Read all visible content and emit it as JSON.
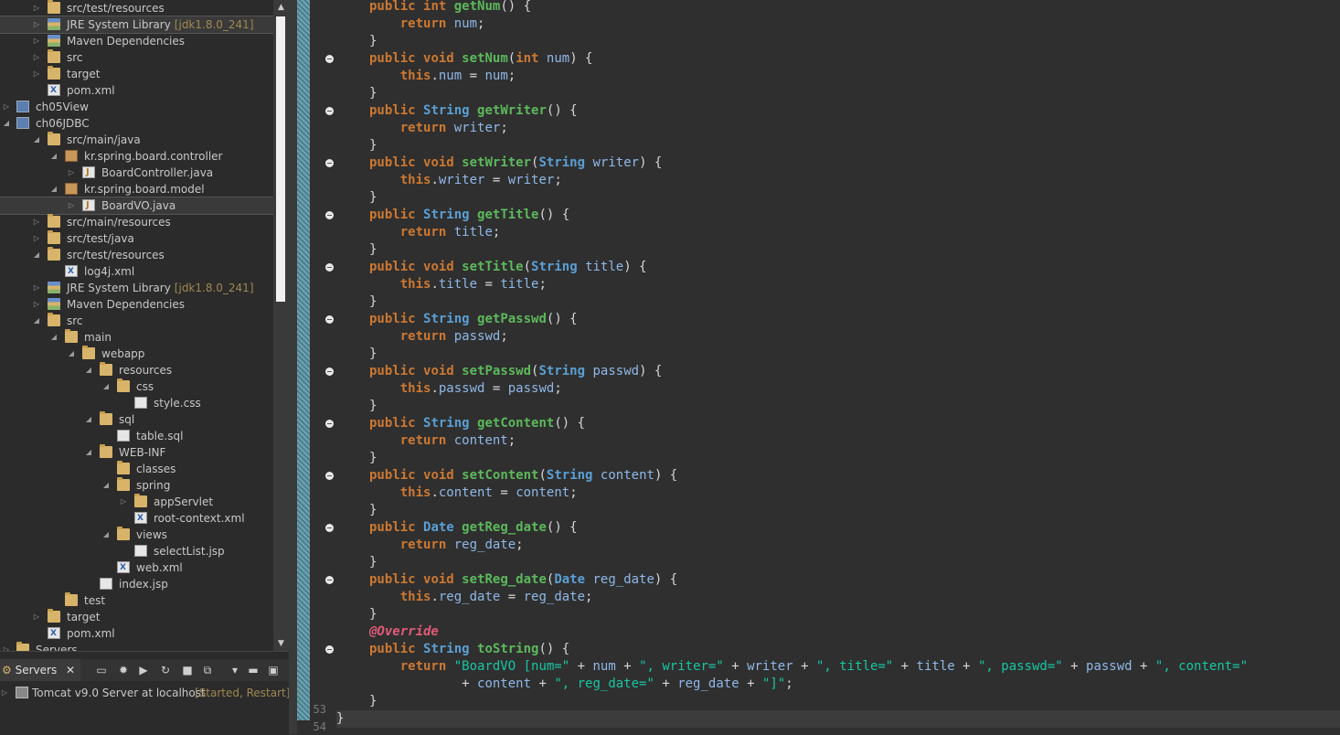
{
  "explorer": {
    "rows": [
      {
        "label": "src/test/resources",
        "decoration": "",
        "indent": 1,
        "twisty": "▷",
        "icon": "folder-icon",
        "sel": false
      },
      {
        "label": "JRE System Library",
        "decoration": "[jdk1.8.0_241]",
        "indent": 1,
        "twisty": "▷",
        "icon": "library-icon",
        "sel": true
      },
      {
        "label": "Maven Dependencies",
        "decoration": "",
        "indent": 1,
        "twisty": "▷",
        "icon": "library-icon",
        "sel": false
      },
      {
        "label": "src",
        "decoration": "",
        "indent": 1,
        "twisty": "▷",
        "icon": "folder-icon",
        "sel": false
      },
      {
        "label": "target",
        "decoration": "",
        "indent": 1,
        "twisty": "▷",
        "icon": "folder-icon",
        "sel": false
      },
      {
        "label": "pom.xml",
        "decoration": "",
        "indent": 1,
        "twisty": "",
        "icon": "xml-file-icon",
        "sel": false
      },
      {
        "label": "ch05View",
        "decoration": "",
        "indent": 0,
        "twisty": "▷",
        "icon": "project-icon",
        "sel": false
      },
      {
        "label": "ch06JDBC",
        "decoration": "",
        "indent": 0,
        "twisty": "◢",
        "icon": "project-icon",
        "sel": false
      },
      {
        "label": "src/main/java",
        "decoration": "",
        "indent": 1,
        "twisty": "◢",
        "icon": "folder-icon",
        "sel": false
      },
      {
        "label": "kr.spring.board.controller",
        "decoration": "",
        "indent": 2,
        "twisty": "◢",
        "icon": "package-icon",
        "sel": false
      },
      {
        "label": "BoardController.java",
        "decoration": "",
        "indent": 3,
        "twisty": "▷",
        "icon": "java-file-icon",
        "sel": false
      },
      {
        "label": "kr.spring.board.model",
        "decoration": "",
        "indent": 2,
        "twisty": "◢",
        "icon": "package-icon",
        "sel": false
      },
      {
        "label": "BoardVO.java",
        "decoration": "",
        "indent": 3,
        "twisty": "▷",
        "icon": "java-file-icon",
        "sel": true
      },
      {
        "label": "src/main/resources",
        "decoration": "",
        "indent": 1,
        "twisty": "▷",
        "icon": "folder-icon",
        "sel": false
      },
      {
        "label": "src/test/java",
        "decoration": "",
        "indent": 1,
        "twisty": "▷",
        "icon": "folder-icon",
        "sel": false
      },
      {
        "label": "src/test/resources",
        "decoration": "",
        "indent": 1,
        "twisty": "◢",
        "icon": "folder-icon",
        "sel": false
      },
      {
        "label": "log4j.xml",
        "decoration": "",
        "indent": 2,
        "twisty": "",
        "icon": "xml-file-icon",
        "sel": false
      },
      {
        "label": "JRE System Library",
        "decoration": "[jdk1.8.0_241]",
        "indent": 1,
        "twisty": "▷",
        "icon": "library-icon",
        "sel": false
      },
      {
        "label": "Maven Dependencies",
        "decoration": "",
        "indent": 1,
        "twisty": "▷",
        "icon": "library-icon",
        "sel": false
      },
      {
        "label": "src",
        "decoration": "",
        "indent": 1,
        "twisty": "◢",
        "icon": "folder-icon",
        "sel": false
      },
      {
        "label": "main",
        "decoration": "",
        "indent": 2,
        "twisty": "◢",
        "icon": "folder-icon",
        "sel": false
      },
      {
        "label": "webapp",
        "decoration": "",
        "indent": 3,
        "twisty": "◢",
        "icon": "folder-icon",
        "sel": false
      },
      {
        "label": "resources",
        "decoration": "",
        "indent": 4,
        "twisty": "◢",
        "icon": "folder-icon",
        "sel": false
      },
      {
        "label": "css",
        "decoration": "",
        "indent": 5,
        "twisty": "◢",
        "icon": "folder-icon",
        "sel": false
      },
      {
        "label": "style.css",
        "decoration": "",
        "indent": 6,
        "twisty": "",
        "icon": "file-icon",
        "sel": false
      },
      {
        "label": "sql",
        "decoration": "",
        "indent": 4,
        "twisty": "◢",
        "icon": "folder-icon",
        "sel": false
      },
      {
        "label": "table.sql",
        "decoration": "",
        "indent": 5,
        "twisty": "",
        "icon": "sql-file-icon",
        "sel": false
      },
      {
        "label": "WEB-INF",
        "decoration": "",
        "indent": 4,
        "twisty": "◢",
        "icon": "folder-icon",
        "sel": false
      },
      {
        "label": "classes",
        "decoration": "",
        "indent": 5,
        "twisty": "",
        "icon": "folder-icon",
        "sel": false
      },
      {
        "label": "spring",
        "decoration": "",
        "indent": 5,
        "twisty": "◢",
        "icon": "folder-icon",
        "sel": false
      },
      {
        "label": "appServlet",
        "decoration": "",
        "indent": 6,
        "twisty": "▷",
        "icon": "folder-icon",
        "sel": false
      },
      {
        "label": "root-context.xml",
        "decoration": "",
        "indent": 6,
        "twisty": "",
        "icon": "xml-file-icon",
        "sel": false
      },
      {
        "label": "views",
        "decoration": "",
        "indent": 5,
        "twisty": "◢",
        "icon": "folder-icon",
        "sel": false
      },
      {
        "label": "selectList.jsp",
        "decoration": "",
        "indent": 6,
        "twisty": "",
        "icon": "file-icon",
        "sel": false
      },
      {
        "label": "web.xml",
        "decoration": "",
        "indent": 5,
        "twisty": "",
        "icon": "xml-file-icon",
        "sel": false
      },
      {
        "label": "index.jsp",
        "decoration": "",
        "indent": 4,
        "twisty": "",
        "icon": "file-icon",
        "sel": false
      },
      {
        "label": "test",
        "decoration": "",
        "indent": 2,
        "twisty": "",
        "icon": "folder-icon",
        "sel": false
      },
      {
        "label": "target",
        "decoration": "",
        "indent": 1,
        "twisty": "▷",
        "icon": "folder-icon",
        "sel": false
      },
      {
        "label": "pom.xml",
        "decoration": "",
        "indent": 1,
        "twisty": "",
        "icon": "xml-file-icon",
        "sel": false
      },
      {
        "label": "Servers",
        "decoration": "",
        "indent": 0,
        "twisty": "▷",
        "icon": "folder-icon",
        "sel": false
      }
    ]
  },
  "servers": {
    "tab_label": "Servers",
    "server_name": "Tomcat v9.0 Server at localhost",
    "server_state": "[Started, Restart]"
  },
  "editor": {
    "visible_line_numbers": [
      "53",
      "54"
    ],
    "code_lines": [
      [
        [
          "kw",
          "public "
        ],
        [
          "kw",
          "int "
        ],
        [
          "fn",
          "getNum"
        ],
        [
          "pl",
          "() {"
        ]
      ],
      [
        [
          "pl",
          "    "
        ],
        [
          "ret",
          "return "
        ],
        [
          "fd",
          "num"
        ],
        [
          "pl",
          ";"
        ]
      ],
      [
        [
          "pl",
          "}"
        ]
      ],
      [
        [
          "kw",
          "public "
        ],
        [
          "kw",
          "void "
        ],
        [
          "fn",
          "setNum"
        ],
        [
          "pl",
          "("
        ],
        [
          "kw",
          "int "
        ],
        [
          "fd",
          "num"
        ],
        [
          "pl",
          ") {"
        ]
      ],
      [
        [
          "pl",
          "    "
        ],
        [
          "kw",
          "this"
        ],
        [
          "pl",
          "."
        ],
        [
          "fd",
          "num"
        ],
        [
          "pl",
          " = "
        ],
        [
          "fd",
          "num"
        ],
        [
          "pl",
          ";"
        ]
      ],
      [
        [
          "pl",
          "}"
        ]
      ],
      [
        [
          "kw",
          "public "
        ],
        [
          "ty",
          "String "
        ],
        [
          "fn",
          "getWriter"
        ],
        [
          "pl",
          "() {"
        ]
      ],
      [
        [
          "pl",
          "    "
        ],
        [
          "ret",
          "return "
        ],
        [
          "fd",
          "writer"
        ],
        [
          "pl",
          ";"
        ]
      ],
      [
        [
          "pl",
          "}"
        ]
      ],
      [
        [
          "kw",
          "public "
        ],
        [
          "kw",
          "void "
        ],
        [
          "fn",
          "setWriter"
        ],
        [
          "pl",
          "("
        ],
        [
          "ty",
          "String "
        ],
        [
          "fd",
          "writer"
        ],
        [
          "pl",
          ") {"
        ]
      ],
      [
        [
          "pl",
          "    "
        ],
        [
          "kw",
          "this"
        ],
        [
          "pl",
          "."
        ],
        [
          "fd",
          "writer"
        ],
        [
          "pl",
          " = "
        ],
        [
          "fd",
          "writer"
        ],
        [
          "pl",
          ";"
        ]
      ],
      [
        [
          "pl",
          "}"
        ]
      ],
      [
        [
          "kw",
          "public "
        ],
        [
          "ty",
          "String "
        ],
        [
          "fn",
          "getTitle"
        ],
        [
          "pl",
          "() {"
        ]
      ],
      [
        [
          "pl",
          "    "
        ],
        [
          "ret",
          "return "
        ],
        [
          "fd",
          "title"
        ],
        [
          "pl",
          ";"
        ]
      ],
      [
        [
          "pl",
          "}"
        ]
      ],
      [
        [
          "kw",
          "public "
        ],
        [
          "kw",
          "void "
        ],
        [
          "fn",
          "setTitle"
        ],
        [
          "pl",
          "("
        ],
        [
          "ty",
          "String "
        ],
        [
          "fd",
          "title"
        ],
        [
          "pl",
          ") {"
        ]
      ],
      [
        [
          "pl",
          "    "
        ],
        [
          "kw",
          "this"
        ],
        [
          "pl",
          "."
        ],
        [
          "fd",
          "title"
        ],
        [
          "pl",
          " = "
        ],
        [
          "fd",
          "title"
        ],
        [
          "pl",
          ";"
        ]
      ],
      [
        [
          "pl",
          "}"
        ]
      ],
      [
        [
          "kw",
          "public "
        ],
        [
          "ty",
          "String "
        ],
        [
          "fn",
          "getPasswd"
        ],
        [
          "pl",
          "() {"
        ]
      ],
      [
        [
          "pl",
          "    "
        ],
        [
          "ret",
          "return "
        ],
        [
          "fd",
          "passwd"
        ],
        [
          "pl",
          ";"
        ]
      ],
      [
        [
          "pl",
          "}"
        ]
      ],
      [
        [
          "kw",
          "public "
        ],
        [
          "kw",
          "void "
        ],
        [
          "fn",
          "setPasswd"
        ],
        [
          "pl",
          "("
        ],
        [
          "ty",
          "String "
        ],
        [
          "fd",
          "passwd"
        ],
        [
          "pl",
          ") {"
        ]
      ],
      [
        [
          "pl",
          "    "
        ],
        [
          "kw",
          "this"
        ],
        [
          "pl",
          "."
        ],
        [
          "fd",
          "passwd"
        ],
        [
          "pl",
          " = "
        ],
        [
          "fd",
          "passwd"
        ],
        [
          "pl",
          ";"
        ]
      ],
      [
        [
          "pl",
          "}"
        ]
      ],
      [
        [
          "kw",
          "public "
        ],
        [
          "ty",
          "String "
        ],
        [
          "fn",
          "getContent"
        ],
        [
          "pl",
          "() {"
        ]
      ],
      [
        [
          "pl",
          "    "
        ],
        [
          "ret",
          "return "
        ],
        [
          "fd",
          "content"
        ],
        [
          "pl",
          ";"
        ]
      ],
      [
        [
          "pl",
          "}"
        ]
      ],
      [
        [
          "kw",
          "public "
        ],
        [
          "kw",
          "void "
        ],
        [
          "fn",
          "setContent"
        ],
        [
          "pl",
          "("
        ],
        [
          "ty",
          "String "
        ],
        [
          "fd",
          "content"
        ],
        [
          "pl",
          ") {"
        ]
      ],
      [
        [
          "pl",
          "    "
        ],
        [
          "kw",
          "this"
        ],
        [
          "pl",
          "."
        ],
        [
          "fd",
          "content"
        ],
        [
          "pl",
          " = "
        ],
        [
          "fd",
          "content"
        ],
        [
          "pl",
          ";"
        ]
      ],
      [
        [
          "pl",
          "}"
        ]
      ],
      [
        [
          "kw",
          "public "
        ],
        [
          "ty",
          "Date "
        ],
        [
          "fn",
          "getReg_date"
        ],
        [
          "pl",
          "() {"
        ]
      ],
      [
        [
          "pl",
          "    "
        ],
        [
          "ret",
          "return "
        ],
        [
          "fd",
          "reg_date"
        ],
        [
          "pl",
          ";"
        ]
      ],
      [
        [
          "pl",
          "}"
        ]
      ],
      [
        [
          "kw",
          "public "
        ],
        [
          "kw",
          "void "
        ],
        [
          "fn",
          "setReg_date"
        ],
        [
          "pl",
          "("
        ],
        [
          "ty",
          "Date "
        ],
        [
          "fd",
          "reg_date"
        ],
        [
          "pl",
          ") {"
        ]
      ],
      [
        [
          "pl",
          "    "
        ],
        [
          "kw",
          "this"
        ],
        [
          "pl",
          "."
        ],
        [
          "fd",
          "reg_date"
        ],
        [
          "pl",
          " = "
        ],
        [
          "fd",
          "reg_date"
        ],
        [
          "pl",
          ";"
        ]
      ],
      [
        [
          "pl",
          "}"
        ]
      ],
      [
        [
          "an",
          "@Override"
        ]
      ],
      [
        [
          "kw",
          "public "
        ],
        [
          "ty",
          "String "
        ],
        [
          "fn",
          "toString"
        ],
        [
          "pl",
          "() {"
        ]
      ],
      [
        [
          "pl",
          "    "
        ],
        [
          "ret",
          "return "
        ],
        [
          "st",
          "\"BoardVO [num=\""
        ],
        [
          "pl",
          " + "
        ],
        [
          "fd",
          "num"
        ],
        [
          "pl",
          " + "
        ],
        [
          "st",
          "\", writer=\""
        ],
        [
          "pl",
          " + "
        ],
        [
          "fd",
          "writer"
        ],
        [
          "pl",
          " + "
        ],
        [
          "st",
          "\", title=\""
        ],
        [
          "pl",
          " + "
        ],
        [
          "fd",
          "title"
        ],
        [
          "pl",
          " + "
        ],
        [
          "st",
          "\", passwd=\""
        ],
        [
          "pl",
          " + "
        ],
        [
          "fd",
          "passwd"
        ],
        [
          "pl",
          " + "
        ],
        [
          "st",
          "\", content=\""
        ]
      ],
      [
        [
          "pl",
          "            + "
        ],
        [
          "fd",
          "content"
        ],
        [
          "pl",
          " + "
        ],
        [
          "st",
          "\", reg_date=\""
        ],
        [
          "pl",
          " + "
        ],
        [
          "fd",
          "reg_date"
        ],
        [
          "pl",
          " + "
        ],
        [
          "st",
          "\"]\""
        ],
        [
          "pl",
          ";"
        ]
      ],
      [
        [
          "pl",
          "}"
        ]
      ],
      [
        [
          "pl",
          "}"
        ]
      ],
      [
        [
          "pl",
          ""
        ]
      ]
    ]
  }
}
